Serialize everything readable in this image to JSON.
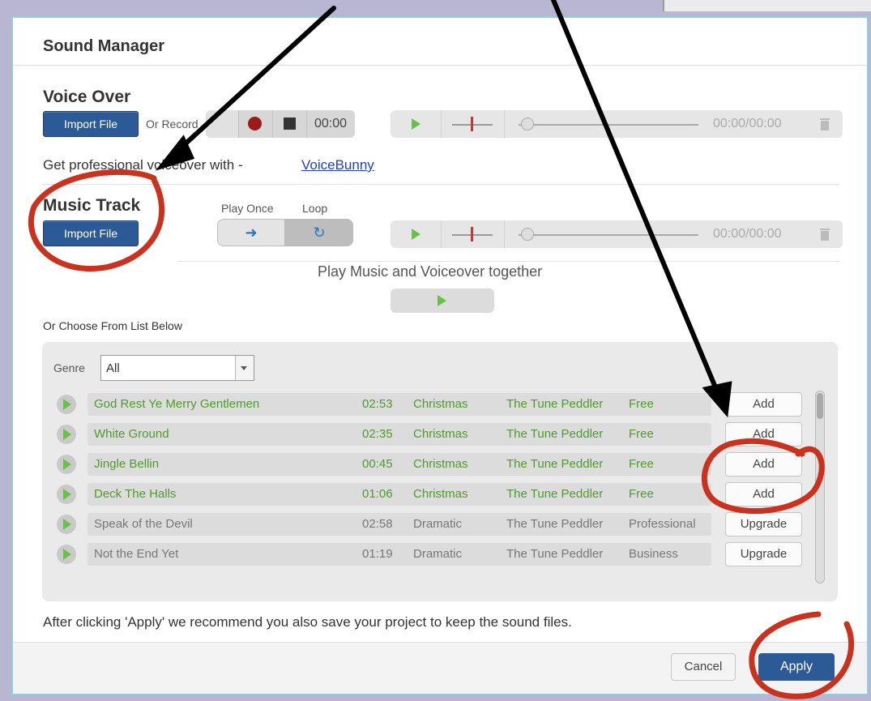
{
  "dialog": {
    "title": "Sound Manager"
  },
  "voice_over": {
    "heading": "Voice Over",
    "import_label": "Import File",
    "or_record_label": "Or Record",
    "record_timer": "00:00",
    "player_time": "00:00/00:00",
    "pro_text": "Get professional voiceover with -",
    "pro_link": "VoiceBunny"
  },
  "music_track": {
    "heading": "Music Track",
    "import_label": "Import File",
    "play_once_label": "Play Once",
    "loop_label": "Loop",
    "player_time": "00:00/00:00",
    "together_label": "Play Music and Voiceover together"
  },
  "library": {
    "choose_label": "Or Choose From List Below",
    "genre_label": "Genre",
    "genre_value": "All",
    "rows": [
      {
        "name": "God Rest Ye Merry Gentlemen",
        "length": "02:53",
        "genre": "Christmas",
        "artist": "The Tune Peddler",
        "tier": "Free",
        "action": "Add",
        "highlight": true
      },
      {
        "name": "White Ground",
        "length": "02:35",
        "genre": "Christmas",
        "artist": "The Tune Peddler",
        "tier": "Free",
        "action": "Add",
        "highlight": true
      },
      {
        "name": "Jingle Bellin",
        "length": "00:45",
        "genre": "Christmas",
        "artist": "The Tune Peddler",
        "tier": "Free",
        "action": "Add",
        "highlight": true
      },
      {
        "name": "Deck The Halls",
        "length": "01:06",
        "genre": "Christmas",
        "artist": "The Tune Peddler",
        "tier": "Free",
        "action": "Add",
        "highlight": true
      },
      {
        "name": "Speak of the Devil",
        "length": "02:58",
        "genre": "Dramatic",
        "artist": "The Tune Peddler",
        "tier": "Professional",
        "action": "Upgrade",
        "highlight": false
      },
      {
        "name": "Not the End Yet",
        "length": "01:19",
        "genre": "Dramatic",
        "artist": "The Tune Peddler",
        "tier": "Business",
        "action": "Upgrade",
        "highlight": false
      }
    ]
  },
  "footer": {
    "note": "After clicking 'Apply' we recommend you also save your project to keep the sound files.",
    "cancel_label": "Cancel",
    "apply_label": "Apply"
  },
  "colors": {
    "accent": "#2b5a96",
    "play_green": "#6ac14a",
    "annotation": "#c8321e"
  }
}
